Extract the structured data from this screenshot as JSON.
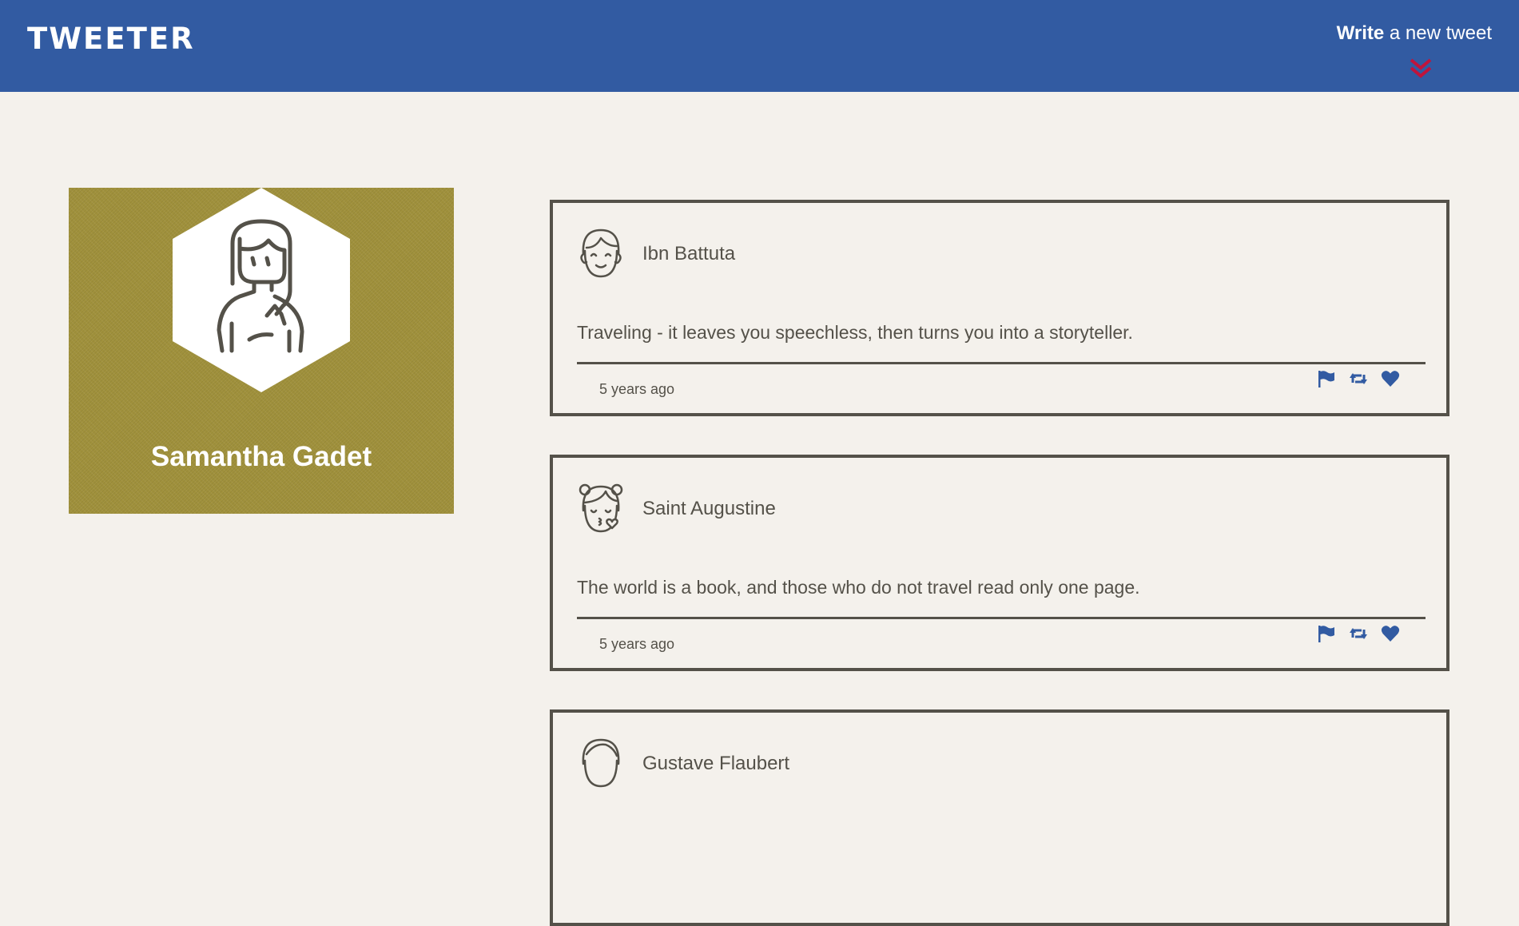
{
  "nav": {
    "brand": "TWEETER",
    "compose_bold": "Write",
    "compose_rest": " a new tweet"
  },
  "profile": {
    "first_name": "Samantha",
    "last_name": "Gadet"
  },
  "tweets": [
    {
      "author": "Ibn Battuta",
      "content": "Traveling - it leaves you speechless, then turns you into a storyteller.",
      "time": "5 years ago",
      "avatar_icon": "man-avatar-icon"
    },
    {
      "author": "Saint Augustine",
      "content": "The world is a book, and those who do not travel read only one page.",
      "time": "5 years ago",
      "avatar_icon": "kissing-girl-avatar-icon"
    },
    {
      "author": "Gustave Flaubert",
      "avatar_icon": "man-avatar-icon"
    }
  ],
  "colors": {
    "nav_bg": "#325ba2",
    "page_bg": "#f4f1ec",
    "text": "#545149",
    "accent_red": "#c0143c",
    "profile_bg": "#a0913c"
  }
}
